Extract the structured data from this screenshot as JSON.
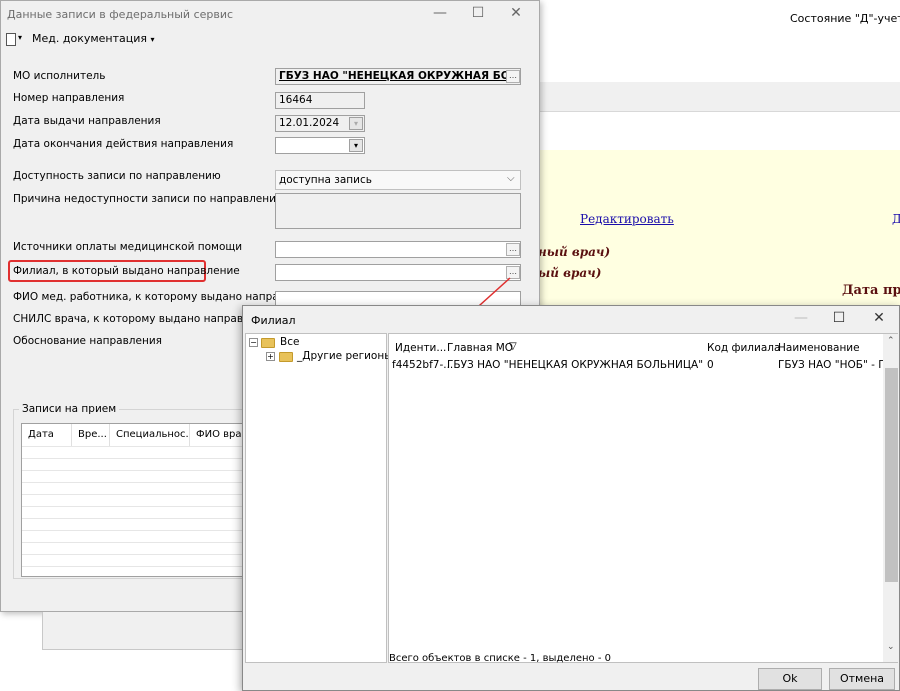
{
  "background": {
    "status_text": "Состояние \"Д\"-учета",
    "link_edit": "Редактировать",
    "link_partial": "Д",
    "italic_line1": "ный врач)",
    "italic_line2": "ый врач)",
    "date_label": "Дата пр"
  },
  "dialog": {
    "title": "Данные записи в федеральный сервис",
    "menu_label": "Мед. документация",
    "fields": [
      {
        "label": "МО исполнитель",
        "value": "ГБУЗ НАО \"НЕНЕЦКАЯ ОКРУЖНАЯ БОЛЬНИЦА\""
      },
      {
        "label": "Номер направления",
        "value": "16464"
      },
      {
        "label": "Дата выдачи направления",
        "value": "12.01.2024"
      },
      {
        "label": "Дата окончания действия направления",
        "value": ""
      },
      {
        "label": "Доступность записи по направлению",
        "value": "доступна запись"
      },
      {
        "label": "Причина недоступности записи по направлению",
        "value": ""
      },
      {
        "label": "Источники оплаты медицинской помощи",
        "value": ""
      },
      {
        "label": "Филиал, в который выдано направление",
        "value": ""
      },
      {
        "label": "ФИО мед. работника, к которому выдано направление",
        "value": ""
      },
      {
        "label": "СНИЛС врача, к которому выдано направление",
        "value": ""
      },
      {
        "label": "Обоснование направления",
        "value": ""
      }
    ],
    "appointments": {
      "title": "Записи на прием",
      "columns": [
        "Дата",
        "Вре...",
        "Специальнос...",
        "ФИО врача"
      ]
    }
  },
  "filial_dialog": {
    "title": "Филиал",
    "tree": {
      "root": "Все",
      "child": "_Другие регионы"
    },
    "columns": [
      "Иденти...",
      "Главная МО",
      "Код филиала",
      "Наименование"
    ],
    "rows": [
      {
        "id": "f4452bf7-...",
        "main_mo": "ГБУЗ НАО \"НЕНЕЦКАЯ ОКРУЖНАЯ БОЛЬНИЦА\"",
        "code": "0",
        "name": "ГБУЗ НАО \"НОБ\" - Пол"
      }
    ],
    "status": "Всего объектов в списке - 1, выделено - 0",
    "ok_label": "Ok",
    "cancel_label": "Отмена"
  },
  "colors": {
    "highlight": "#e03030",
    "arrow": "#e03030",
    "yellow_panel": "#ffffe1"
  }
}
